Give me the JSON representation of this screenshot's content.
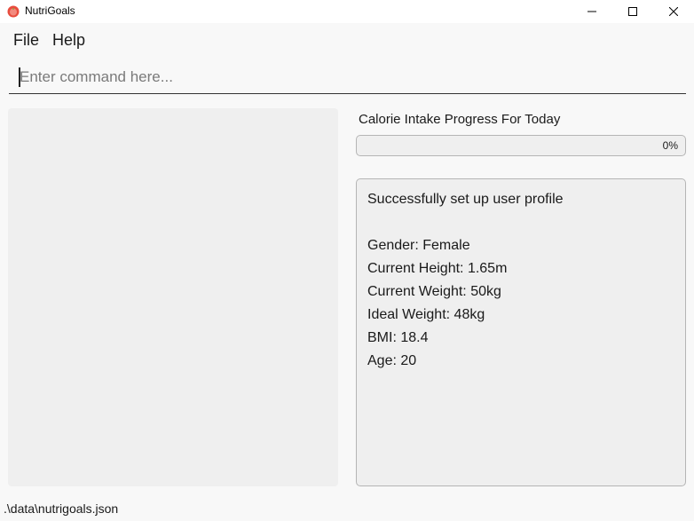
{
  "window": {
    "title": "NutriGoals",
    "icon": "apple-icon",
    "controls": [
      "minimize-icon",
      "maximize-icon",
      "close-icon"
    ]
  },
  "menu": {
    "items": [
      {
        "label": "File"
      },
      {
        "label": "Help"
      }
    ]
  },
  "command": {
    "placeholder": "Enter command here...",
    "value": ""
  },
  "progress": {
    "title": "Calorie Intake Progress For Today",
    "value": 0,
    "label": "0%"
  },
  "result": {
    "lines": [
      "Successfully set up user profile",
      "",
      "Gender: Female",
      "Current Height: 1.65m",
      "Current Weight: 50kg",
      "Ideal Weight: 48kg",
      "BMI: 18.4",
      "Age: 20"
    ]
  },
  "status": {
    "file_path": ".\\data\\nutrigoals.json"
  },
  "colors": {
    "background": "#f8f8f8",
    "panel": "#efefef",
    "border": "#b5b5b5",
    "icon_red": "#e84c3d"
  }
}
